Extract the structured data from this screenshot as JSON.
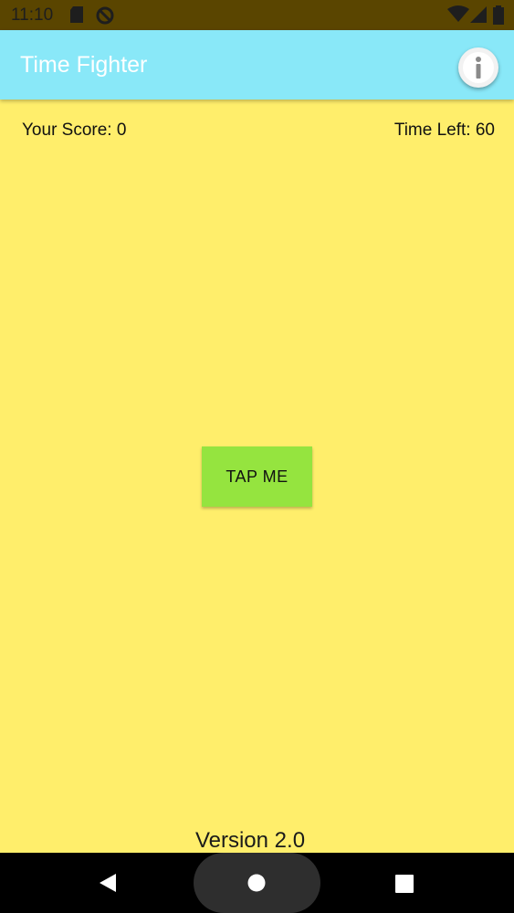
{
  "status_bar": {
    "time": "11:10",
    "icons": [
      "sd-card-icon",
      "do-not-disturb-icon",
      "wifi-icon",
      "signal-icon",
      "battery-icon"
    ]
  },
  "app_bar": {
    "title": "Time Fighter",
    "info_icon": "info-icon",
    "color": "#89E8F8"
  },
  "game": {
    "score_text": "Your Score: 0",
    "time_left_text": "Time Left: 60",
    "tap_button_label": "TAP ME",
    "button_color": "#95E43F",
    "background_color": "#FFEE6B"
  },
  "footer": {
    "version_text": "Version 2.0"
  },
  "nav_bar": {
    "buttons": [
      "back-icon",
      "home-icon",
      "recents-icon"
    ]
  }
}
